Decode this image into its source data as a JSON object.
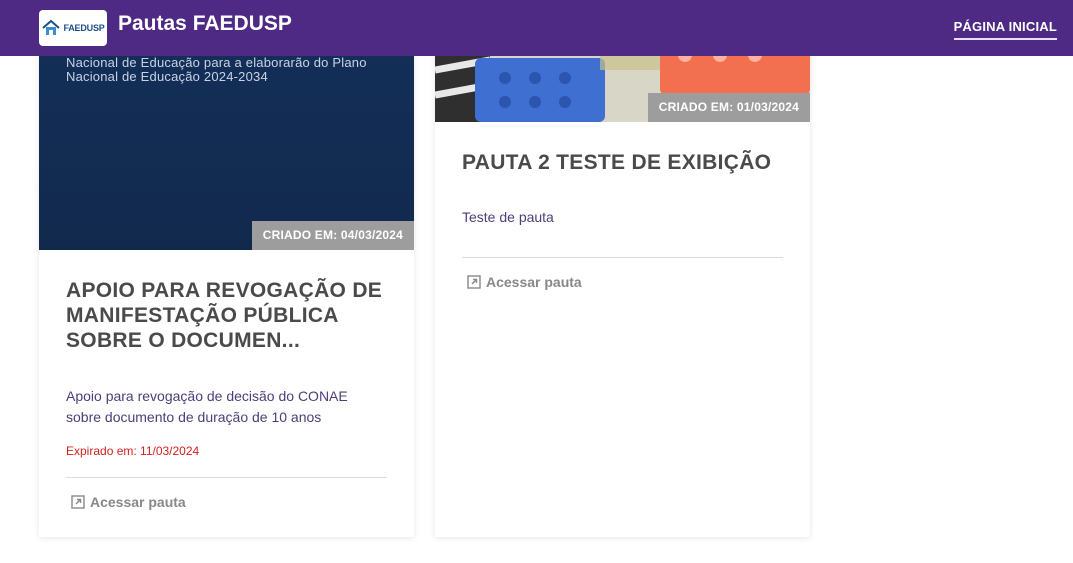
{
  "header": {
    "logo_text": "FAEDUSP",
    "title": "Pautas FAEDUSP",
    "nav_home": "PÁGINA INICIAL"
  },
  "colors": {
    "header_bg": "#4e2a84",
    "badge_bg": "#9d9d9d",
    "expired": "#d42020",
    "description": "#4e3d7a"
  },
  "cards": [
    {
      "image_text": "sobre o Documento Referência da Conferência Nacional de Educação para a elaborarão do Plano Nacional de Educação 2024-2034",
      "created": "CRIADO EM: 04/03/2024",
      "title": "APOIO PARA REVOGAÇÃO DE MANIFESTAÇÃO PÚBLICA SOBRE O DOCUMEN...",
      "description": "Apoio para revogação de decisão do CONAE sobre documento de duração de 10 anos",
      "expired": "Expirado em: 11/03/2024",
      "link": "Acessar pauta",
      "link_icon": "external-link-icon"
    },
    {
      "created": "CRIADO EM: 01/03/2024",
      "title": "PAUTA 2 TESTE DE EXIBIÇÃO",
      "description": "Teste de pauta",
      "link": "Acessar pauta",
      "link_icon": "external-link-icon"
    }
  ]
}
